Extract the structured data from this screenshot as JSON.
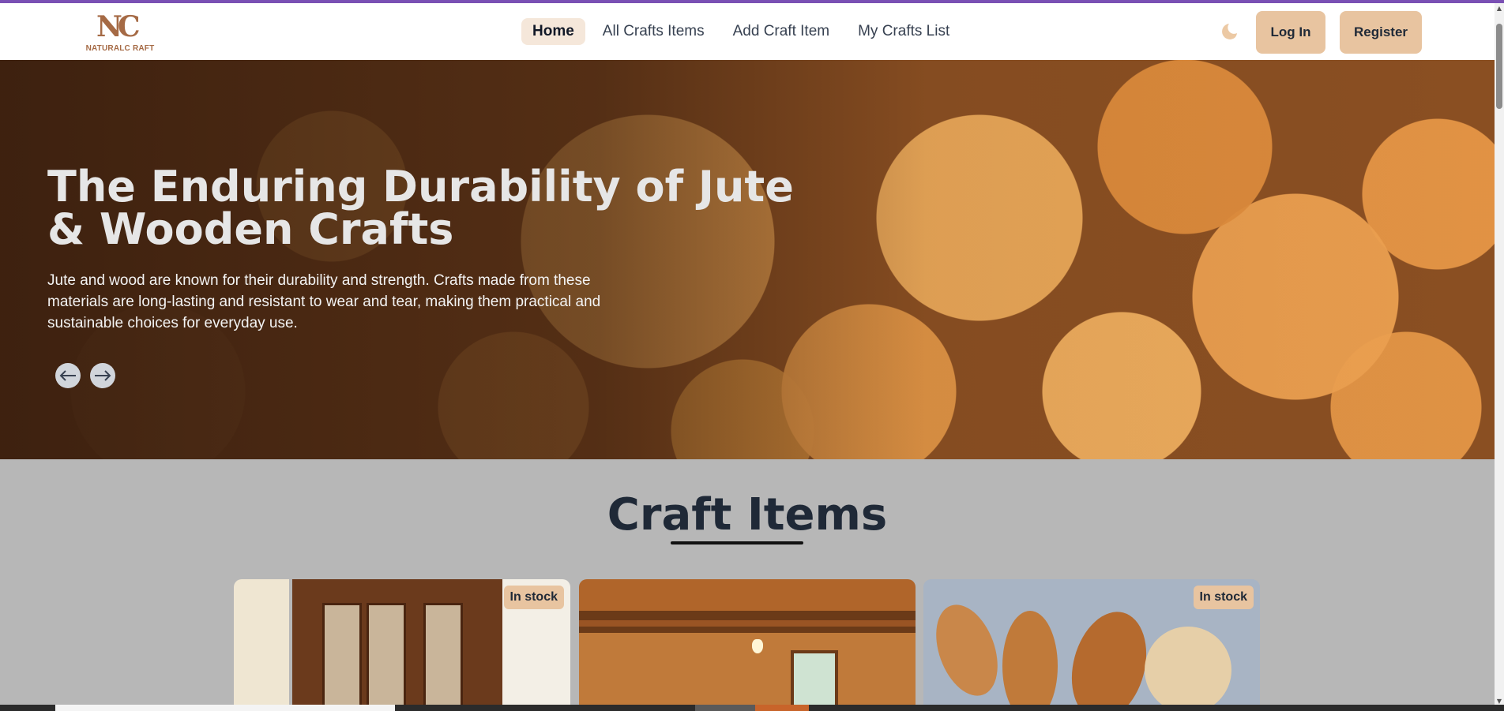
{
  "brand": {
    "mark": "NC",
    "name": "NATURALC RAFT",
    "color": "#a56a45"
  },
  "nav": {
    "items": [
      {
        "label": "Home",
        "active": true
      },
      {
        "label": "All Crafts Items",
        "active": false
      },
      {
        "label": "Add Craft Item",
        "active": false
      },
      {
        "label": "My Crafts List",
        "active": false
      }
    ],
    "theme_toggle_icon": "moon-icon",
    "login_label": "Log In",
    "register_label": "Register",
    "accent_color": "#e8c4a0"
  },
  "hero": {
    "title": "The Enduring Durability of Jute & Wooden Crafts",
    "description": "Jute and wood are known for their durability and strength. Crafts made from these materials are long-lasting and resistant to wear and tear, making them practical and sustainable choices for everyday use.",
    "prev_icon": "arrow-left-icon",
    "next_icon": "arrow-right-icon"
  },
  "section": {
    "title": "Craft Items",
    "cards": [
      {
        "image": "wooden-cabinet",
        "badge": "In stock"
      },
      {
        "image": "log-cabin-interior",
        "badge": ""
      },
      {
        "image": "wooden-spoons",
        "badge": "In stock"
      }
    ]
  }
}
